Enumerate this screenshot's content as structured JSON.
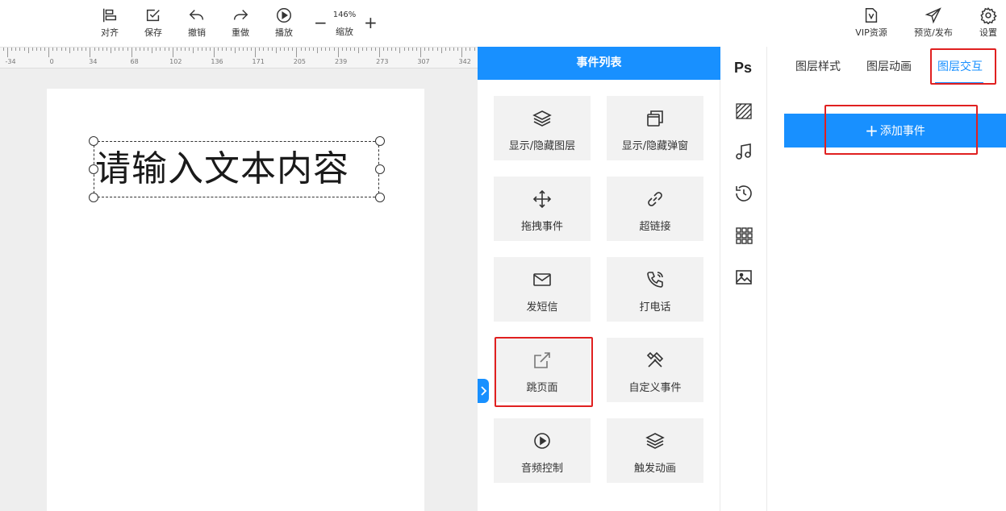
{
  "toolbar": {
    "align_label": "对齐",
    "save_label": "保存",
    "undo_label": "撤销",
    "redo_label": "重做",
    "play_label": "播放",
    "zoom_value": "146%",
    "zoom_label": "缩放",
    "zoom_minus": "−",
    "zoom_plus": "+",
    "vip_label": "VIP资源",
    "preview_label": "预览/发布",
    "settings_label": "设置"
  },
  "ruler": {
    "labels": [
      "-34",
      "0",
      "34",
      "68",
      "102",
      "136",
      "171",
      "205",
      "239",
      "273",
      "307",
      "342"
    ]
  },
  "canvas": {
    "text_content": "请输入文本内容"
  },
  "event_panel": {
    "title": "事件列表",
    "items": [
      {
        "label": "显示/隐藏图层",
        "icon": "layers-icon"
      },
      {
        "label": "显示/隐藏弹窗",
        "icon": "popup-icon"
      },
      {
        "label": "拖拽事件",
        "icon": "move-icon"
      },
      {
        "label": "超链接",
        "icon": "link-icon"
      },
      {
        "label": "发短信",
        "icon": "mail-icon"
      },
      {
        "label": "打电话",
        "icon": "phone-icon"
      },
      {
        "label": "跳页面",
        "icon": "external-link-icon"
      },
      {
        "label": "自定义事件",
        "icon": "tools-icon"
      },
      {
        "label": "音频控制",
        "icon": "play-circle-icon"
      },
      {
        "label": "触发动画",
        "icon": "layers-icon"
      }
    ]
  },
  "icon_strip": {
    "ps_label": "Ps"
  },
  "properties": {
    "tabs": [
      {
        "label": "图层样式",
        "active": false
      },
      {
        "label": "图层动画",
        "active": false
      },
      {
        "label": "图层交互",
        "active": true
      }
    ],
    "add_event_plus": "+",
    "add_event_label": "添加事件"
  },
  "colors": {
    "accent": "#1890ff",
    "highlight_box": "#e02020",
    "card_bg": "#f2f2f2",
    "canvas_bg": "#eeeeee"
  }
}
